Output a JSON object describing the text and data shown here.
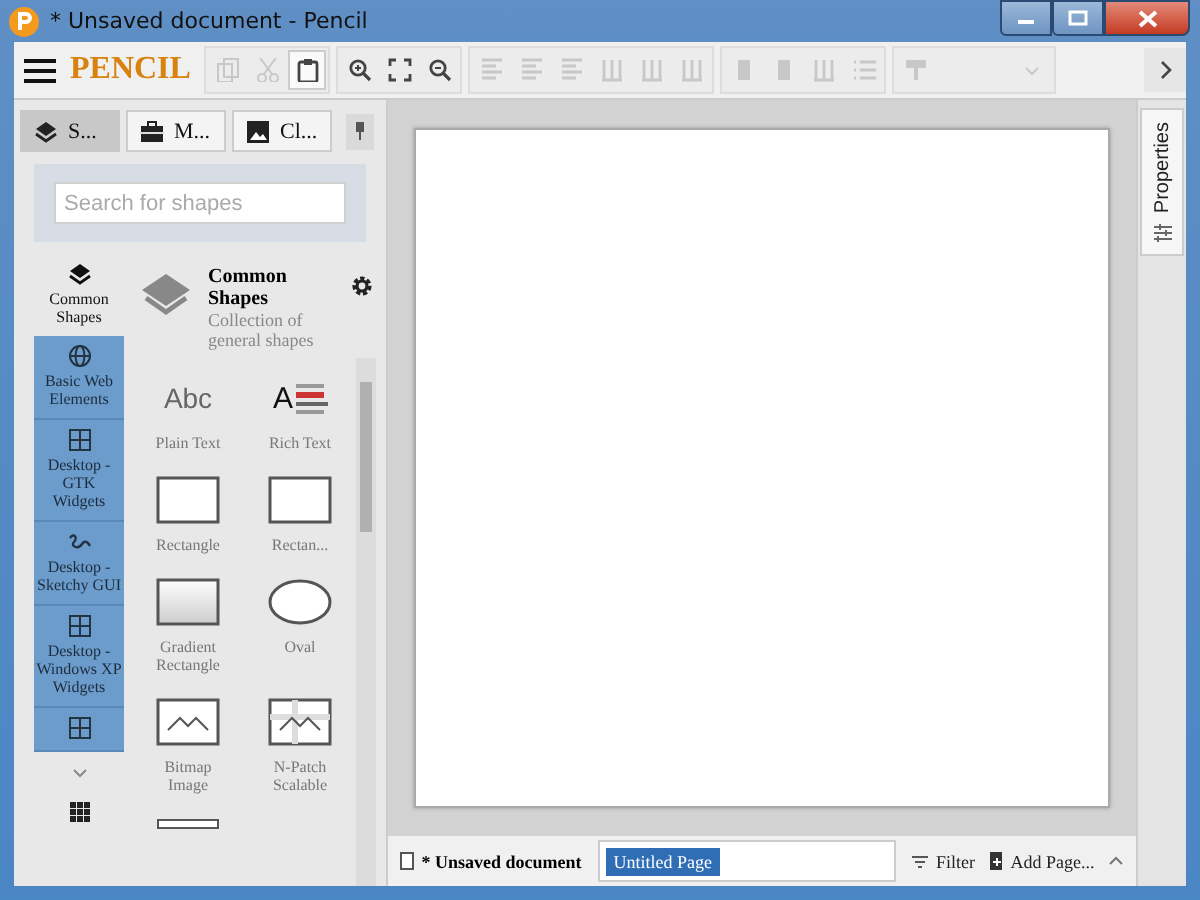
{
  "window": {
    "title": "* Unsaved document - Pencil"
  },
  "toolbar": {
    "logo": "PENCIL",
    "groups": [
      [
        {
          "kind": "copy",
          "disabled": true
        },
        {
          "kind": "cut",
          "disabled": true
        },
        {
          "kind": "paste",
          "disabled": false
        }
      ],
      [
        {
          "kind": "zoom-in",
          "disabled": false
        },
        {
          "kind": "fit",
          "disabled": false
        },
        {
          "kind": "zoom-out",
          "disabled": false
        }
      ],
      [
        {
          "kind": "align",
          "disabled": true
        },
        {
          "kind": "align",
          "disabled": true
        },
        {
          "kind": "align",
          "disabled": true
        },
        {
          "kind": "bars",
          "disabled": true
        },
        {
          "kind": "bars",
          "disabled": true
        },
        {
          "kind": "bars",
          "disabled": true
        }
      ],
      [
        {
          "kind": "block",
          "disabled": true
        },
        {
          "kind": "block",
          "disabled": true
        },
        {
          "kind": "bars",
          "disabled": true
        },
        {
          "kind": "list",
          "disabled": true
        }
      ],
      [
        {
          "kind": "brush",
          "disabled": true
        },
        {
          "kind": "dropdown",
          "disabled": true
        }
      ],
      [
        {
          "kind": "chevron",
          "disabled": false
        }
      ]
    ]
  },
  "sidebar": {
    "tabs": [
      {
        "label": "S...",
        "kind": "layers",
        "selected": true
      },
      {
        "label": "M...",
        "kind": "briefcase",
        "selected": false
      },
      {
        "label": "Cl...",
        "kind": "image",
        "selected": false
      }
    ],
    "search": {
      "placeholder": "Search for shapes"
    },
    "categories": [
      {
        "label": "Common Shapes",
        "kind": "layers",
        "selected": true
      },
      {
        "label": "Basic Web Elements",
        "kind": "globe",
        "selected": false
      },
      {
        "label": "Desktop - GTK Widgets",
        "kind": "grid",
        "selected": false
      },
      {
        "label": "Desktop - Sketchy GUI",
        "kind": "squiggle",
        "selected": false
      },
      {
        "label": "Desktop - Windows XP Widgets",
        "kind": "grid",
        "selected": false
      },
      {
        "kind": "grid",
        "selected": false
      }
    ],
    "collection": {
      "title": "Common Shapes",
      "description": "Collection of general shapes"
    },
    "shapes": [
      {
        "label": "Plain Text",
        "kind": "text",
        "preview": "Abc"
      },
      {
        "label": "Rich Text",
        "kind": "richtext",
        "preview": "A"
      },
      {
        "label": "Rectangle",
        "kind": "rect"
      },
      {
        "label": "Rectan...",
        "kind": "rect"
      },
      {
        "label": "Gradient Rectangle",
        "kind": "gradient"
      },
      {
        "label": "Oval",
        "kind": "oval"
      },
      {
        "label": "Bitmap Image",
        "kind": "bitmap"
      },
      {
        "label": "N-Patch Scalable",
        "kind": "npatch"
      },
      {
        "kind": "line"
      }
    ]
  },
  "right_panel": {
    "tab": "Properties"
  },
  "bottom_bar": {
    "document": "* Unsaved document",
    "pages": [
      {
        "label": "Untitled Page",
        "selected": true
      }
    ],
    "filter": "Filter",
    "add_page": "Add Page..."
  }
}
